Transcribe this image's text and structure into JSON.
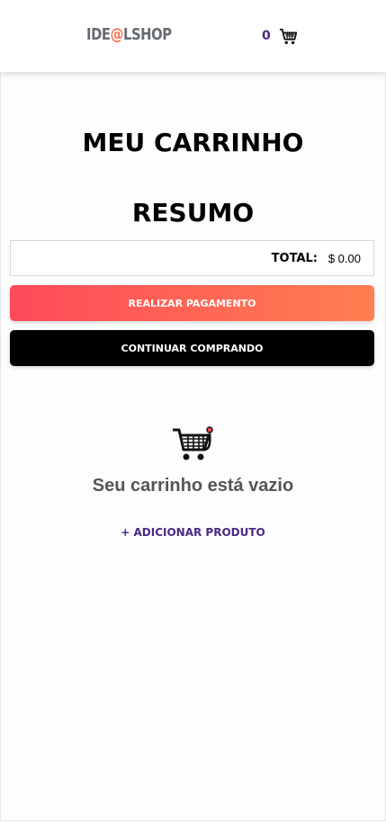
{
  "header": {
    "logo_part1": "IDE",
    "logo_at": "@",
    "logo_part2": "LSHOP",
    "cart_count": "0",
    "cart_icon": "shopping-cart-icon"
  },
  "page": {
    "title": "MEU CARRINHO",
    "summary_title": "RESUMO"
  },
  "summary": {
    "total_label": "TOTAL:",
    "total_value": "$ 0.00"
  },
  "buttons": {
    "pay": "REALIZAR PAGAMENTO",
    "continue": "CONTINUAR COMPRANDO"
  },
  "empty_state": {
    "icon": "shopping-cart-icon",
    "message": "Seu carrinho está vazio",
    "add_link": "+ ADICIONAR PRODUTO"
  },
  "colors": {
    "accent_purple": "#4a2a86",
    "logo_at": "#ff6b4a",
    "pay_gradient_start": "#ff4a5a",
    "pay_gradient_end": "#ff7f50"
  }
}
